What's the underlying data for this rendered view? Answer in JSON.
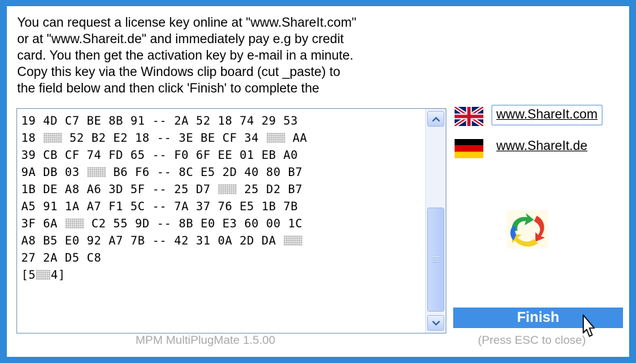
{
  "instructions": [
    "You can request a license key online at \"www.ShareIt.com\"",
    "or at \"www.Shareit.de\" and immediately pay e.g by credit",
    "card. You then get the activation key by e-mail in a minute.",
    "Copy this key via the Windows clip board (cut _paste) to",
    "the field below and then click 'Finish' to complete the"
  ],
  "key_lines": [
    [
      "19 4D C7 BE 8B 91 -- 2A 52 18 74 29 53"
    ],
    [
      "18 ",
      "#",
      " 52 B2 E2 18 -- 3E BE CF 34 ",
      "#",
      " AA"
    ],
    [
      "39 CB CF 74 FD 65 -- F0 6F EE 01 EB A0"
    ],
    [
      "9A DB 03 ",
      "#",
      " B6 F6 -- 8C E5 2D 40 80 B7"
    ],
    [
      "1B DE A8 A6 3D 5F -- 25 D7 ",
      "#",
      " 25 D2 B7"
    ],
    [
      "A5 91 1A A7 F1 5C -- 7A 37 76 E5 1B 7B"
    ],
    [
      "3F 6A ",
      "#",
      " C2 55 9D -- 8B E0 E3 60 00 1C"
    ],
    [
      "A8 B5 E0 92 A7 7B -- 42 31 0A 2D DA ",
      "#"
    ],
    [
      "27 2A D5 C8"
    ],
    [
      "[5",
      "s",
      "4]"
    ]
  ],
  "links": {
    "com": "www.ShareIt.com",
    "de": "www.ShareIt.de"
  },
  "icons": {
    "uk_flag": "flag-uk-icon",
    "de_flag": "flag-de-icon",
    "logo": "multiplugmate-logo-icon",
    "cursor": "mouse-pointer-icon"
  },
  "buttons": {
    "finish": "Finish"
  },
  "hint": "(Press ESC to close)",
  "footer": "MPM MultiPlugMate 1.5.00",
  "colors": {
    "frame": "#2f88d8",
    "finish_button": "#3f8fe6",
    "muted_text": "#a8a8a8"
  }
}
